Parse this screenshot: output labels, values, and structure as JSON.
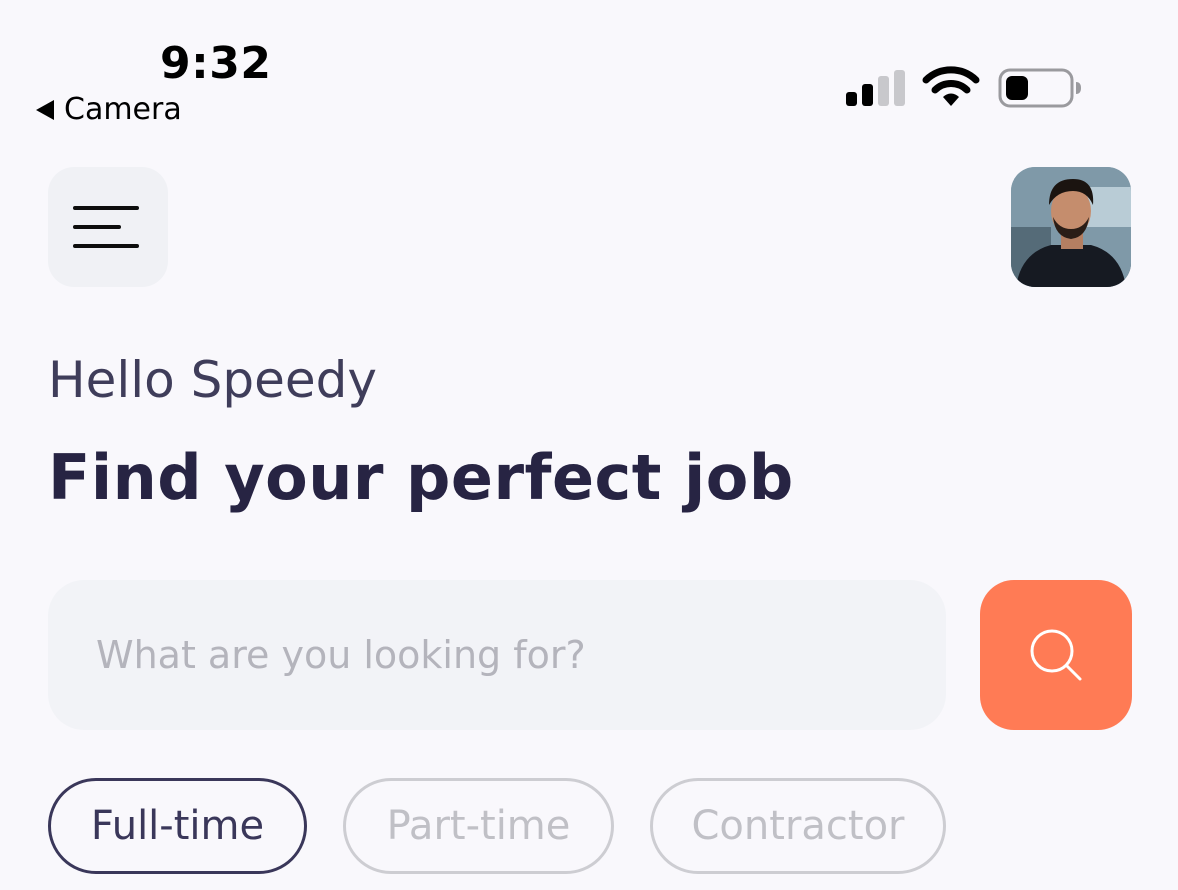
{
  "status_bar": {
    "time": "9:32",
    "back_label": "Camera"
  },
  "header": {
    "menu_icon": "menu-icon",
    "avatar": "profile-avatar"
  },
  "greeting": "Hello Speedy",
  "headline": "Find your perfect job",
  "search": {
    "placeholder": "What are you looking for?",
    "icon": "search-icon",
    "button_color": "#ff7b55"
  },
  "filters": [
    {
      "label": "Full-time",
      "active": true
    },
    {
      "label": "Part-time",
      "active": false
    },
    {
      "label": "Contractor",
      "active": false
    }
  ]
}
